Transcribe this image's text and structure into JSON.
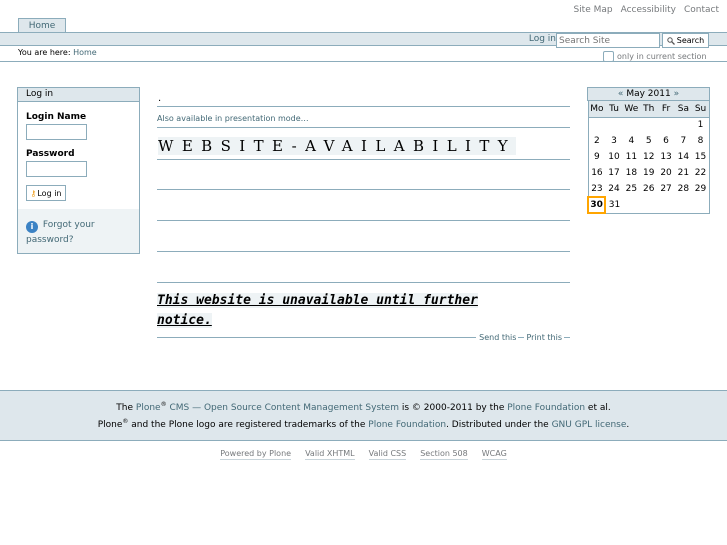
{
  "site_actions": [
    "Site Map",
    "Accessibility",
    "Contact"
  ],
  "tabs": [
    {
      "label": "Home"
    }
  ],
  "personal_bar": {
    "login_label": "Log in",
    "search_placeholder": "Search Site",
    "search_button": "Search",
    "section_only_label": "only in current section"
  },
  "breadcrumbs": {
    "prefix": "You are here:",
    "current": "Home"
  },
  "login_portlet": {
    "title": "Log in",
    "login_name_label": "Login Name",
    "password_label": "Password",
    "login_button": "Log in",
    "forgot_line1": "Forgot your",
    "forgot_line2": "password?"
  },
  "content": {
    "dot": ".",
    "presentation_link": "Also available in presentation mode…",
    "big_title": "WEBSITE-AVAILABILITY",
    "notice_line1": "This website is unavailable until further",
    "notice_line2": "notice.",
    "send_this": "Send this",
    "print_this": "Print this"
  },
  "calendar": {
    "prev": "«",
    "next": "»",
    "month": "May 2011",
    "weekdays": [
      "Mo",
      "Tu",
      "We",
      "Th",
      "Fr",
      "Sa",
      "Su"
    ],
    "weeks": [
      [
        "",
        "",
        "",
        "",
        "",
        "",
        "1"
      ],
      [
        "2",
        "3",
        "4",
        "5",
        "6",
        "7",
        "8"
      ],
      [
        "9",
        "10",
        "11",
        "12",
        "13",
        "14",
        "15"
      ],
      [
        "16",
        "17",
        "18",
        "19",
        "20",
        "21",
        "22"
      ],
      [
        "23",
        "24",
        "25",
        "26",
        "27",
        "28",
        "29"
      ],
      [
        "30",
        "31",
        "",
        "",
        "",
        "",
        ""
      ]
    ],
    "today": "30"
  },
  "footer": {
    "l1_the": "The",
    "l1_plone": "Plone",
    "l1_reg": "®",
    "l1_cms": "CMS — Open Source Content Management System",
    "l1_is": "is © 2000-2011 by the",
    "l1_foundation": "Plone Foundation",
    "l1_etal": "et al.",
    "l2_plone": "Plone",
    "l2_reg": "®",
    "l2_text": "and the Plone logo are registered trademarks of the",
    "l2_foundation": "Plone Foundation",
    "l2_dist": ". Distributed under the",
    "l2_gpl": "GNU GPL license",
    "l2_end": "."
  },
  "colophon": [
    "Powered by Plone",
    "Valid XHTML",
    "Valid CSS",
    "Section 508",
    "WCAG"
  ]
}
